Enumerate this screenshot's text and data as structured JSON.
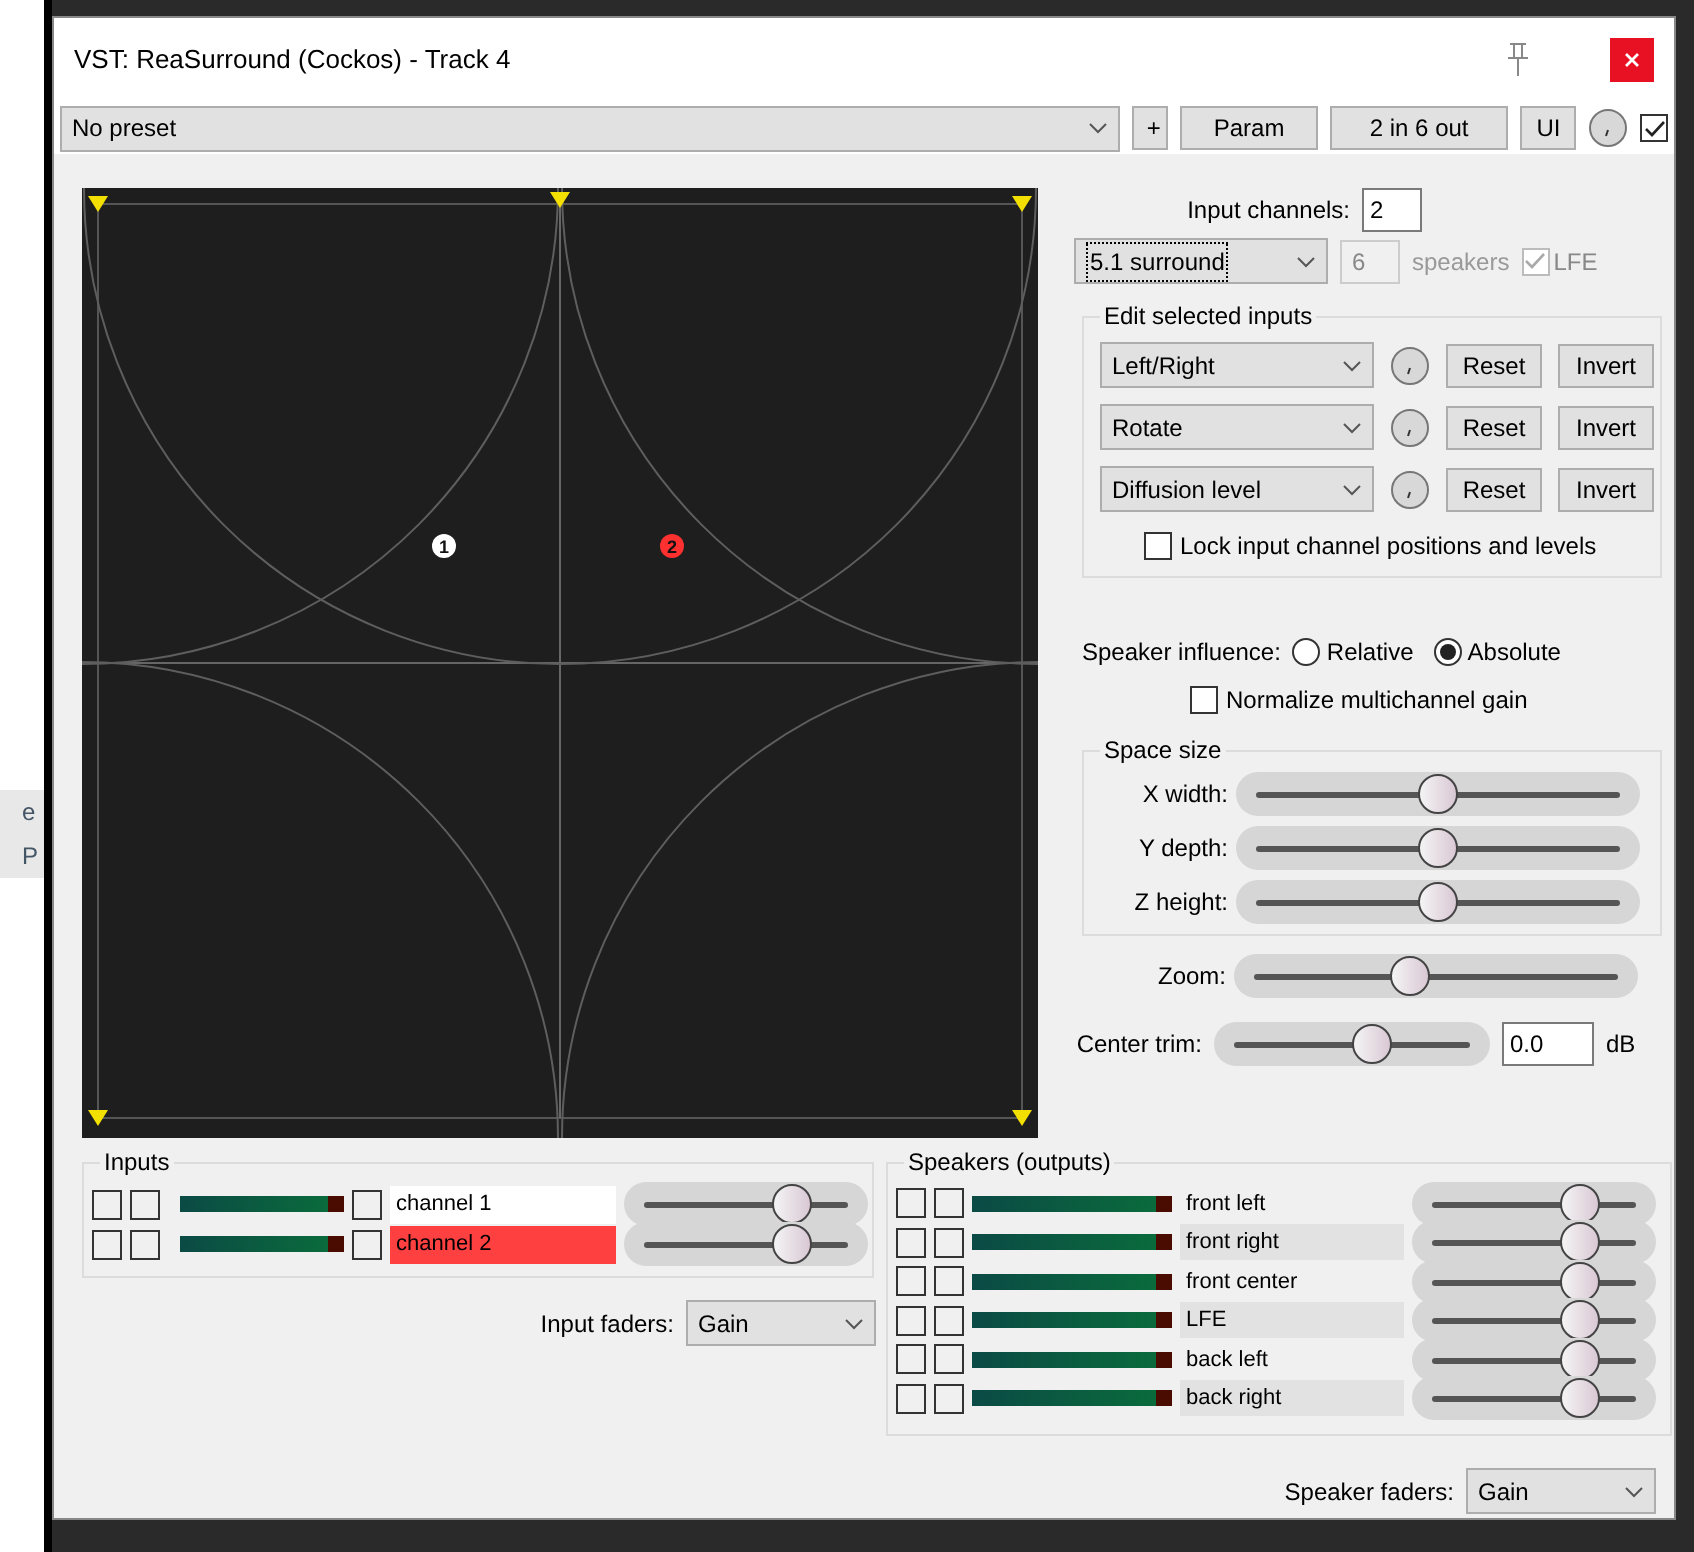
{
  "background_fragments": [
    "e",
    "P"
  ],
  "window": {
    "title": "VST: ReaSurround (Cockos) - Track 4"
  },
  "toolbar": {
    "preset": "No preset",
    "buttons": [
      "+",
      "Param",
      "2 in 6 out",
      "UI"
    ],
    "enabled": {
      "checked": true
    }
  },
  "pad": {
    "channels": [
      {
        "label": "1",
        "color": "#ffffff"
      },
      {
        "label": "2",
        "color": "#ff3030"
      }
    ]
  },
  "settings": {
    "input_channels_label": "Input channels:",
    "input_channels": "2",
    "layout": "5.1 surround",
    "speakers": "6",
    "speakers_label": "speakers",
    "lfe": {
      "label": "LFE",
      "checked": true,
      "disabled": true
    }
  },
  "edit_selected_inputs": {
    "title": "Edit selected inputs",
    "rows": [
      {
        "parameter": "Left/Right",
        "reset": "Reset",
        "invert": "Invert"
      },
      {
        "parameter": "Rotate",
        "reset": "Reset",
        "invert": "Invert"
      },
      {
        "parameter": "Diffusion level",
        "reset": "Reset",
        "invert": "Invert"
      }
    ],
    "lock": {
      "label": "Lock input channel positions and levels",
      "checked": false
    }
  },
  "speaker_influence": {
    "label": "Speaker influence:",
    "options": [
      {
        "label": "Relative",
        "selected": false
      },
      {
        "label": "Absolute",
        "selected": true
      }
    ],
    "normalize": {
      "label": "Normalize multichannel gain",
      "checked": false
    }
  },
  "space_size": {
    "title": "Space size",
    "sliders": [
      {
        "label": "X width:",
        "level": 0.5
      },
      {
        "label": "Y depth:",
        "level": 0.5
      },
      {
        "label": "Z height:",
        "level": 0.5
      }
    ]
  },
  "zoom": {
    "label": "Zoom:",
    "level": 0.42
  },
  "center_trim": {
    "label": "Center trim:",
    "level": 0.6,
    "value": "0.0",
    "unit": "dB"
  },
  "inputs": {
    "title": "Inputs",
    "rows": [
      {
        "name": "channel 1",
        "selected": false,
        "level": 0.78
      },
      {
        "name": "channel 2",
        "selected": true,
        "level": 0.78
      }
    ],
    "faders_label": "Input faders:",
    "faders_mode": "Gain"
  },
  "speakers": {
    "title": "Speakers (outputs)",
    "rows": [
      {
        "name": "front left",
        "level": 0.78
      },
      {
        "name": "front right",
        "level": 0.78
      },
      {
        "name": "front center",
        "level": 0.78
      },
      {
        "name": "LFE",
        "level": 0.78
      },
      {
        "name": "back left",
        "level": 0.78
      },
      {
        "name": "back right",
        "level": 0.78
      }
    ],
    "faders_label": "Speaker faders:",
    "faders_mode": "Gain"
  }
}
